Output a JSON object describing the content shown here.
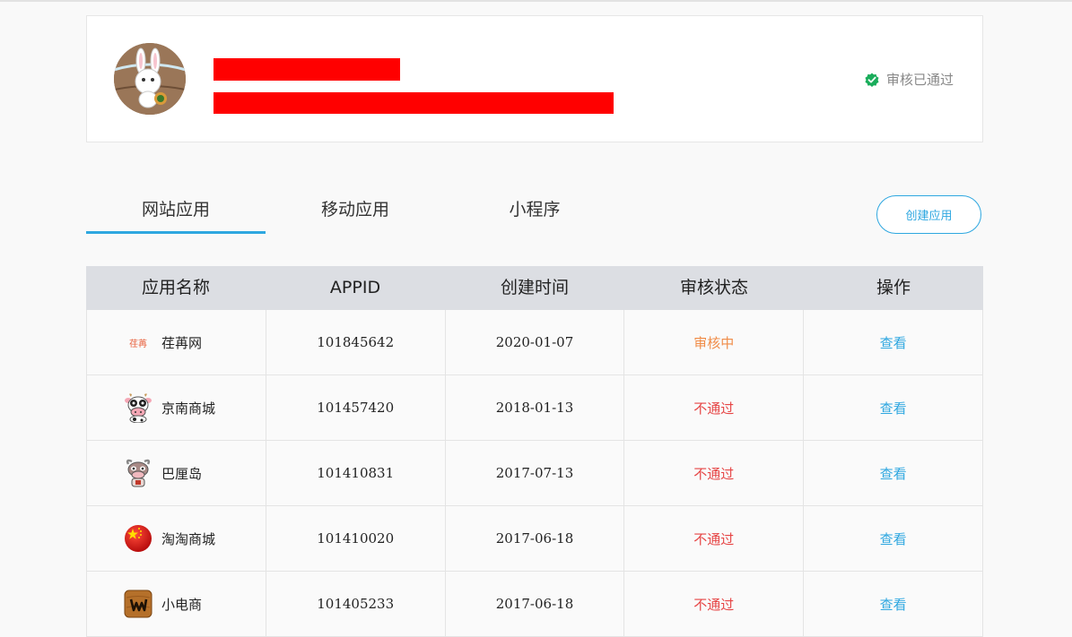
{
  "profile": {
    "verified_text": "审核已通过",
    "colors": {
      "verified": "#1aad5b",
      "redaction": "#ff0000"
    }
  },
  "tabs": [
    {
      "label": "网站应用",
      "active": true
    },
    {
      "label": "移动应用",
      "active": false
    },
    {
      "label": "小程序",
      "active": false
    }
  ],
  "create_button": "创建应用",
  "table": {
    "headers": [
      "应用名称",
      "APPID",
      "创建时间",
      "审核状态",
      "操作"
    ],
    "rows": [
      {
        "icon": "text-logo",
        "icon_text": "荏苒",
        "name": "荏苒网",
        "appid": "101845642",
        "date": "2020-01-07",
        "status": "审核中",
        "status_type": "pending",
        "action": "查看"
      },
      {
        "icon": "cow-icon",
        "name": "京南商城",
        "appid": "101457420",
        "date": "2018-01-13",
        "status": "不通过",
        "status_type": "fail",
        "action": "查看"
      },
      {
        "icon": "bull-icon",
        "name": "巴厘岛",
        "appid": "101410831",
        "date": "2017-07-13",
        "status": "不通过",
        "status_type": "fail",
        "action": "查看"
      },
      {
        "icon": "china-flag-icon",
        "name": "淘淘商城",
        "appid": "101410020",
        "date": "2017-06-18",
        "status": "不通过",
        "status_type": "fail",
        "action": "查看"
      },
      {
        "icon": "wood-w-icon",
        "name": "小电商",
        "appid": "101405233",
        "date": "2017-06-18",
        "status": "不通过",
        "status_type": "fail",
        "action": "查看"
      }
    ]
  },
  "colors": {
    "accent": "#2ea7e0",
    "pending": "#f08c48",
    "fail": "#e64545",
    "header_bg": "#dcdee3"
  }
}
